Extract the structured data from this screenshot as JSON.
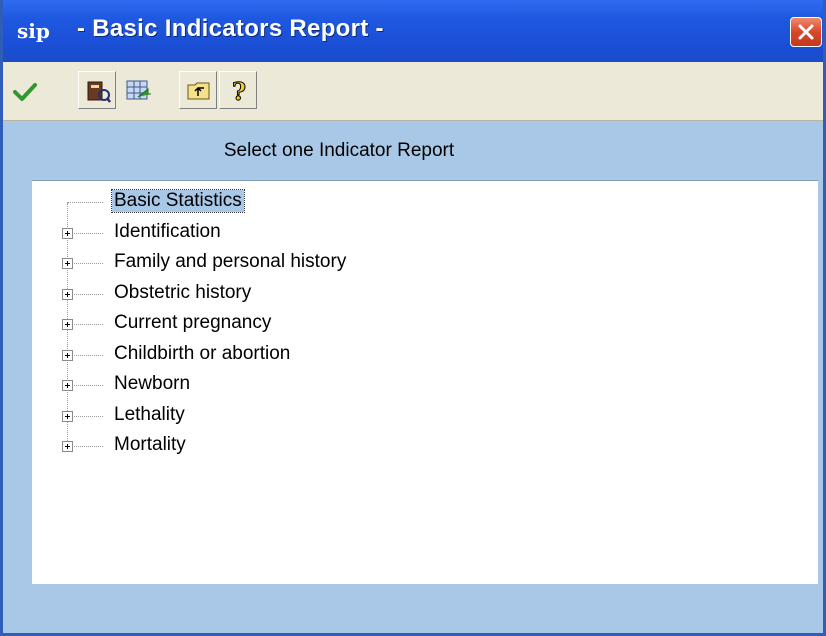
{
  "window": {
    "title": "- Basic Indicators Report -",
    "app_logo_text": "sip"
  },
  "toolbar": {
    "buttons": [
      {
        "icon": "checkmark-icon",
        "label": "OK"
      },
      {
        "icon": "report-book-icon",
        "label": "Report"
      },
      {
        "icon": "grid-export-icon",
        "label": "Export"
      },
      {
        "icon": "folder-up-icon",
        "label": "Up"
      },
      {
        "icon": "help-question-icon",
        "label": "Help"
      }
    ]
  },
  "main": {
    "heading": "Select one Indicator Report"
  },
  "tree": {
    "items": [
      {
        "label": "Basic Statistics",
        "selected": true,
        "expandable": false
      },
      {
        "label": "Identification",
        "selected": false,
        "expandable": true
      },
      {
        "label": "Family and personal history",
        "selected": false,
        "expandable": true
      },
      {
        "label": "Obstetric history",
        "selected": false,
        "expandable": true
      },
      {
        "label": "Current pregnancy",
        "selected": false,
        "expandable": true
      },
      {
        "label": "Childbirth or abortion",
        "selected": false,
        "expandable": true
      },
      {
        "label": "Newborn",
        "selected": false,
        "expandable": true
      },
      {
        "label": "Lethality",
        "selected": false,
        "expandable": true
      },
      {
        "label": "Mortality",
        "selected": false,
        "expandable": true
      }
    ]
  },
  "colors": {
    "titlebar": "#1f58e0",
    "toolbar_bg": "#ece9d8",
    "window_bg": "#a9c8e8",
    "selection_bg": "#a9c8e8",
    "close_button": "#d8472a"
  }
}
